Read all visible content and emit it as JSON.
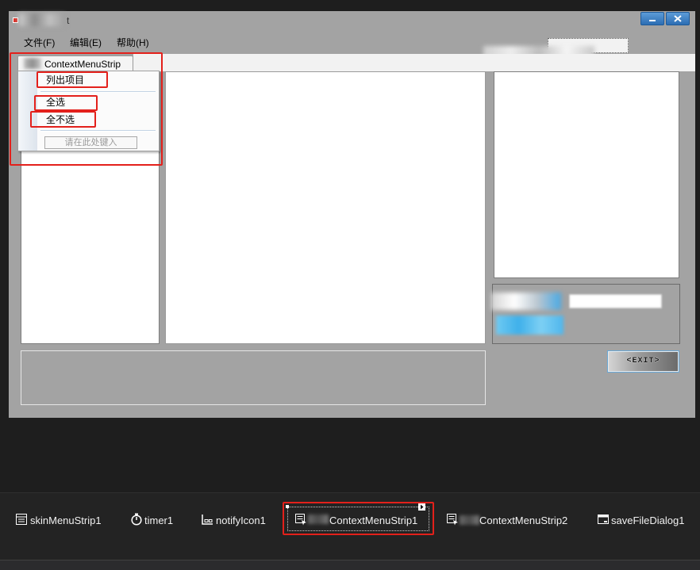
{
  "window": {
    "title": "t"
  },
  "menubar": {
    "items": [
      {
        "label": "文件(F)"
      },
      {
        "label": "编辑(E)"
      },
      {
        "label": "帮助(H)"
      }
    ]
  },
  "context_menu_designer": {
    "tab_label": "ContextMenuStrip",
    "items": [
      {
        "label": "列出项目"
      },
      {
        "label": "全选"
      },
      {
        "label": "全不选"
      }
    ],
    "type_here_placeholder": "请在此处键入"
  },
  "exit_button": {
    "label": "<EXIT>"
  },
  "component_tray": {
    "items": [
      {
        "label": "skinMenuStrip1",
        "icon": "menu-strip-icon"
      },
      {
        "label": "timer1",
        "icon": "timer-icon"
      },
      {
        "label": "notifyIcon1",
        "icon": "notify-icon-icon"
      },
      {
        "label": "ContextMenuStrip1",
        "icon": "context-menu-strip-icon",
        "selected": true
      },
      {
        "label": "ContextMenuStrip2",
        "icon": "context-menu-strip-icon"
      },
      {
        "label": "saveFileDialog1",
        "icon": "save-file-dialog-icon"
      }
    ]
  },
  "colors": {
    "ide_background": "#1e1e1e",
    "form_background": "#a3a3a3",
    "title_button_blue": "#2c6db3",
    "annotation_red": "#e3201b",
    "tray_text": "#f1f1f1"
  }
}
